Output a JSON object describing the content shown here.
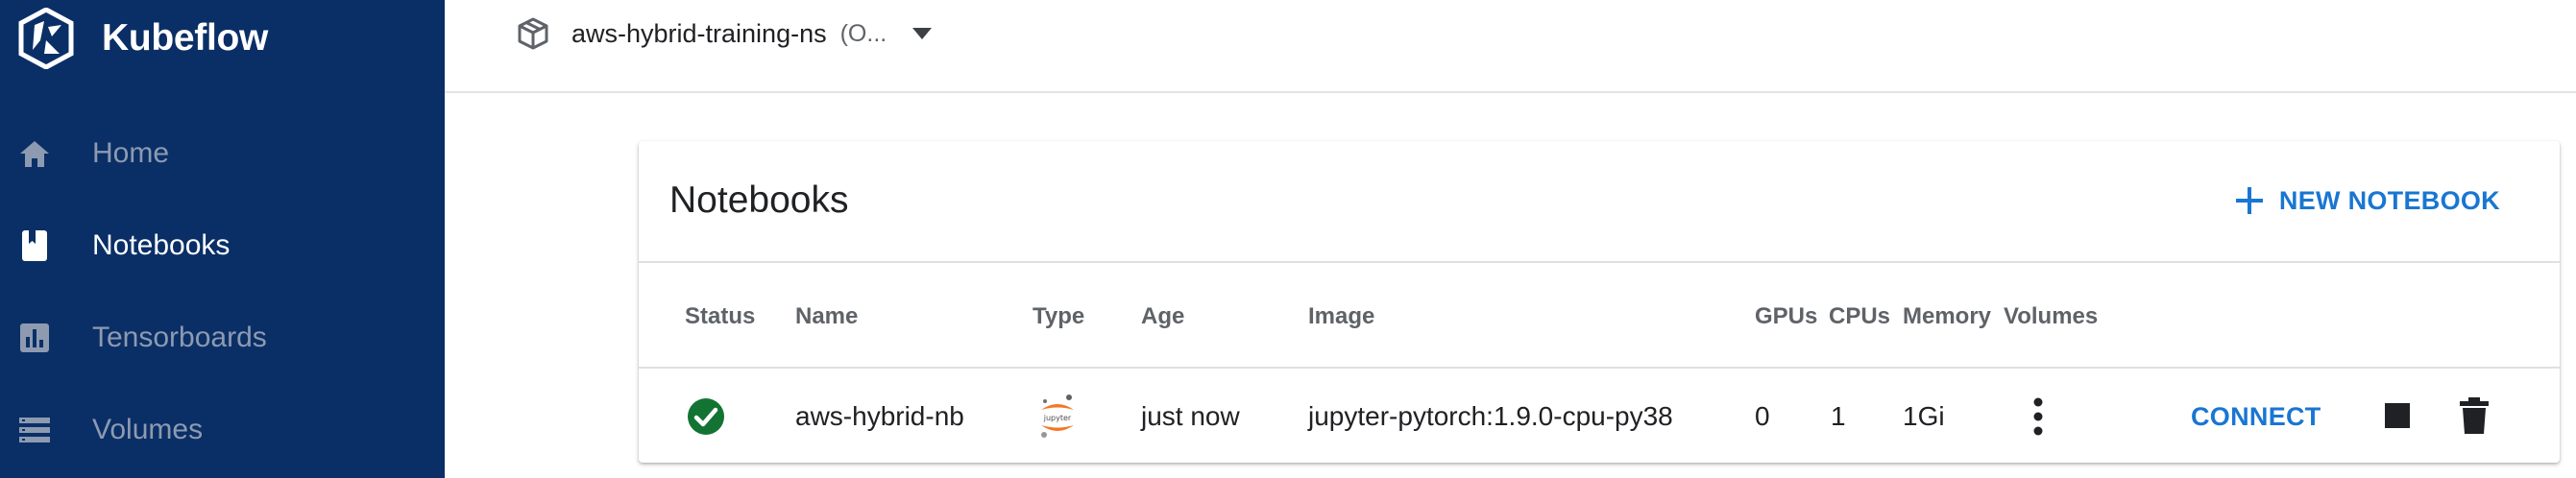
{
  "brand": {
    "name": "Kubeflow",
    "logo_icon": "kubeflow-logo-icon"
  },
  "sidebar": {
    "items": [
      {
        "label": "Home",
        "icon": "home-icon",
        "active": false
      },
      {
        "label": "Notebooks",
        "icon": "notebook-icon",
        "active": true
      },
      {
        "label": "Tensorboards",
        "icon": "bar-chart-icon",
        "active": false
      },
      {
        "label": "Volumes",
        "icon": "storage-icon",
        "active": false
      }
    ]
  },
  "namespace": {
    "name": "aws-hybrid-training-ns",
    "extra": "(O...",
    "icon": "box-icon"
  },
  "card": {
    "title": "Notebooks",
    "new_button": "NEW NOTEBOOK"
  },
  "table": {
    "headers": [
      "Status",
      "Name",
      "Type",
      "Age",
      "Image",
      "GPUs",
      "CPUs",
      "Memory",
      "Volumes"
    ],
    "rows": [
      {
        "status": "ready",
        "name": "aws-hybrid-nb",
        "type": "jupyter",
        "age": "just now",
        "image": "jupyter-pytorch:1.9.0-cpu-py38",
        "gpus": "0",
        "cpus": "1",
        "memory": "1Gi",
        "connect": "CONNECT"
      }
    ]
  },
  "colors": {
    "sidebar_bg": "#0a2f67",
    "accent": "#1976d2",
    "status_ok": "#137333",
    "jupyter_orange": "#f37726"
  }
}
